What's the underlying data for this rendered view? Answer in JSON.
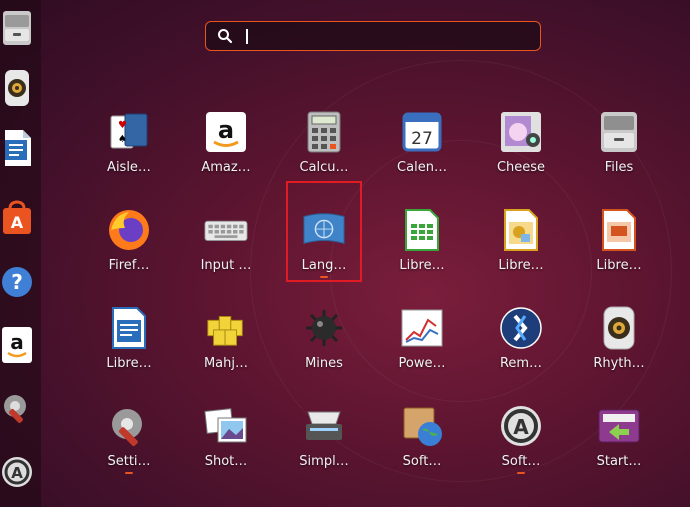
{
  "search": {
    "placeholder": "",
    "value": ""
  },
  "dock": {
    "items": [
      {
        "name": "files-dock"
      },
      {
        "name": "rhythmbox-dock"
      },
      {
        "name": "libreoffice-writer-dock"
      },
      {
        "name": "software-dock"
      },
      {
        "name": "help-dock"
      },
      {
        "name": "amazon-dock"
      },
      {
        "name": "settings-dock"
      },
      {
        "name": "software-updater-dock"
      }
    ]
  },
  "apps": [
    {
      "label": "Aisle…",
      "icon": "cards-icon",
      "running": false
    },
    {
      "label": "Amaz…",
      "icon": "amazon-icon",
      "running": false
    },
    {
      "label": "Calcu…",
      "icon": "calculator-icon",
      "running": false
    },
    {
      "label": "Calen…",
      "icon": "calendar-icon",
      "running": false,
      "calendar_day": "27"
    },
    {
      "label": "Cheese",
      "icon": "cheese-icon",
      "running": false
    },
    {
      "label": "Files",
      "icon": "file-cabinet-icon",
      "running": false
    },
    {
      "label": "Firef…",
      "icon": "firefox-icon",
      "running": false
    },
    {
      "label": "Input …",
      "icon": "keyboard-icon",
      "running": false
    },
    {
      "label": "Lang…",
      "icon": "language-flag-icon",
      "running": true
    },
    {
      "label": "Libre…",
      "icon": "calc-sheet-icon",
      "running": false
    },
    {
      "label": "Libre…",
      "icon": "draw-icon",
      "running": false
    },
    {
      "label": "Libre…",
      "icon": "impress-icon",
      "running": false
    },
    {
      "label": "Libre…",
      "icon": "writer-doc-icon",
      "running": false
    },
    {
      "label": "Mahj…",
      "icon": "mahjongg-icon",
      "running": false
    },
    {
      "label": "Mines",
      "icon": "mine-icon",
      "running": false
    },
    {
      "label": "Powe…",
      "icon": "power-chart-icon",
      "running": false
    },
    {
      "label": "Rem…",
      "icon": "remmina-icon",
      "running": false
    },
    {
      "label": "Rhyth…",
      "icon": "speaker-icon",
      "running": false
    },
    {
      "label": "Setti…",
      "icon": "settings-tools-icon",
      "running": true
    },
    {
      "label": "Shot…",
      "icon": "shotwell-photos-icon",
      "running": false
    },
    {
      "label": "Simpl…",
      "icon": "scanner-icon",
      "running": false
    },
    {
      "label": "Soft…",
      "icon": "software-globe-icon",
      "running": false
    },
    {
      "label": "Soft…",
      "icon": "software-updater-icon",
      "running": true
    },
    {
      "label": "Start…",
      "icon": "startup-disk-icon",
      "running": false
    }
  ],
  "colors": {
    "accent": "#e9541f",
    "selection": "#e01b24"
  }
}
